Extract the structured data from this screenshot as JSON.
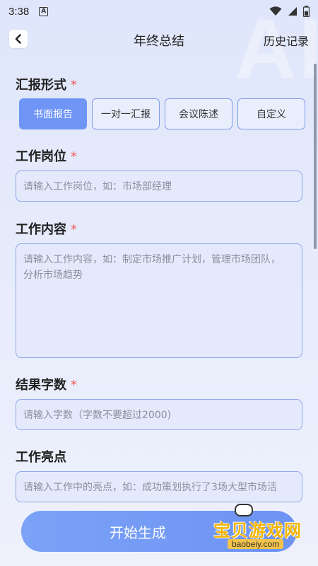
{
  "status": {
    "time": "3:38",
    "a_badge": "A"
  },
  "header": {
    "title": "年终总结",
    "history_label": "历史记录"
  },
  "background_text": "AI",
  "report_format": {
    "label": "汇报形式",
    "required_mark": "*",
    "options": [
      "书面报告",
      "一对一汇报",
      "会议陈述",
      "自定义"
    ],
    "selected_index": 0
  },
  "job_title": {
    "label": "工作岗位",
    "required_mark": "*",
    "placeholder": "请输入工作岗位，如：市场部经理"
  },
  "work_content": {
    "label": "工作内容",
    "required_mark": "*",
    "placeholder_line1": "请输入工作内容，如：制定市场推广计划，管理市场团队，",
    "placeholder_line2": "分析市场趋势"
  },
  "word_count": {
    "label": "结果字数",
    "required_mark": "*",
    "placeholder": "请输入字数（字数不要超过2000)"
  },
  "highlights": {
    "label": "工作亮点",
    "placeholder": "请输入工作中的亮点，如：成功策划执行了3场大型市场活"
  },
  "generate_button": "开始生成",
  "watermark": {
    "cn": "宝贝游戏网",
    "en": "baobeiy.com"
  },
  "colors": {
    "accent": "#6f95f7",
    "required": "#f25757"
  }
}
